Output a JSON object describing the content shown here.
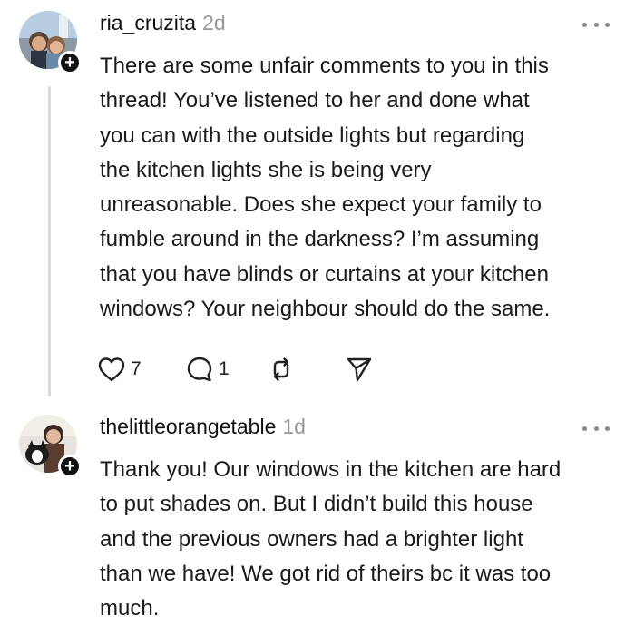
{
  "posts": [
    {
      "username": "ria_cruzita",
      "timestamp": "2d",
      "avatar_icon": "profile-photo",
      "follow_icon": "plus-icon",
      "follow_glyph": "+",
      "text": "There are some unfair comments to you in this\nthread! You’ve listened to her and done what\nyou can with the outside lights but regarding\nthe kitchen lights she is being very\nunreasonable. Does she expect your family to\nfumble around in the darkness? I’m assuming\nthat you have blinds or curtains at your kitchen\nwindows? Your neighbour should do the same.",
      "likes": "7",
      "replies": "1"
    },
    {
      "username": "thelittleorangetable",
      "timestamp": "1d",
      "avatar_icon": "profile-photo",
      "follow_icon": "plus-icon",
      "follow_glyph": "+",
      "text": "Thank you! Our windows in the kitchen are hard\nto put shades on. But I didn’t build this house\nand the previous owners had a brighter light\nthan we have! We got rid of theirs bc it was too\nmuch."
    }
  ],
  "icons": {
    "more": "more-horizontal-icon",
    "like": "heart-icon",
    "reply": "comment-icon",
    "repost": "repost-icon",
    "share": "send-icon"
  }
}
